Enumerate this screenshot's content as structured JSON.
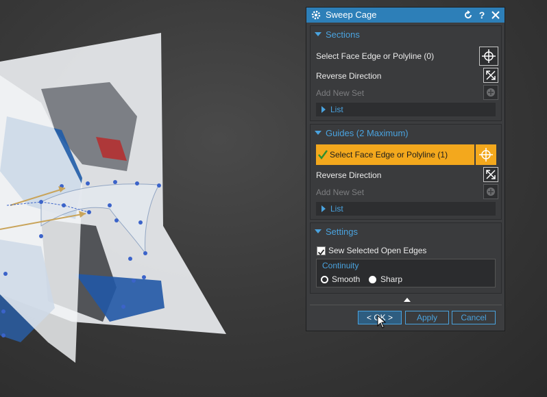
{
  "dialog": {
    "title": "Sweep Cage",
    "titlebar_icons": [
      "gear-icon",
      "reset-icon",
      "help-icon",
      "close-icon"
    ],
    "help_glyph": "?"
  },
  "sections": {
    "label": "Sections",
    "select_label": "Select Face Edge or Polyline (0)",
    "reverse_label": "Reverse Direction",
    "add_label": "Add New Set",
    "list_label": "List"
  },
  "guides": {
    "label": "Guides (2 Maximum)",
    "select_label": "Select Face Edge or Polyline (1)",
    "reverse_label": "Reverse Direction",
    "add_label": "Add New Set",
    "list_label": "List"
  },
  "settings": {
    "label": "Settings",
    "sew_label": "Sew Selected Open Edges",
    "sew_checked": true,
    "continuity_label": "Continuity",
    "options": [
      "Smooth",
      "Sharp"
    ],
    "selected": "Sharp"
  },
  "buttons": {
    "ok": "< OK >",
    "apply": "Apply",
    "cancel": "Cancel"
  },
  "colors": {
    "accent": "#4aa3df",
    "titlebar": "#2d7fb8",
    "highlight": "#f3a81d",
    "panel": "#3c3d3f"
  }
}
